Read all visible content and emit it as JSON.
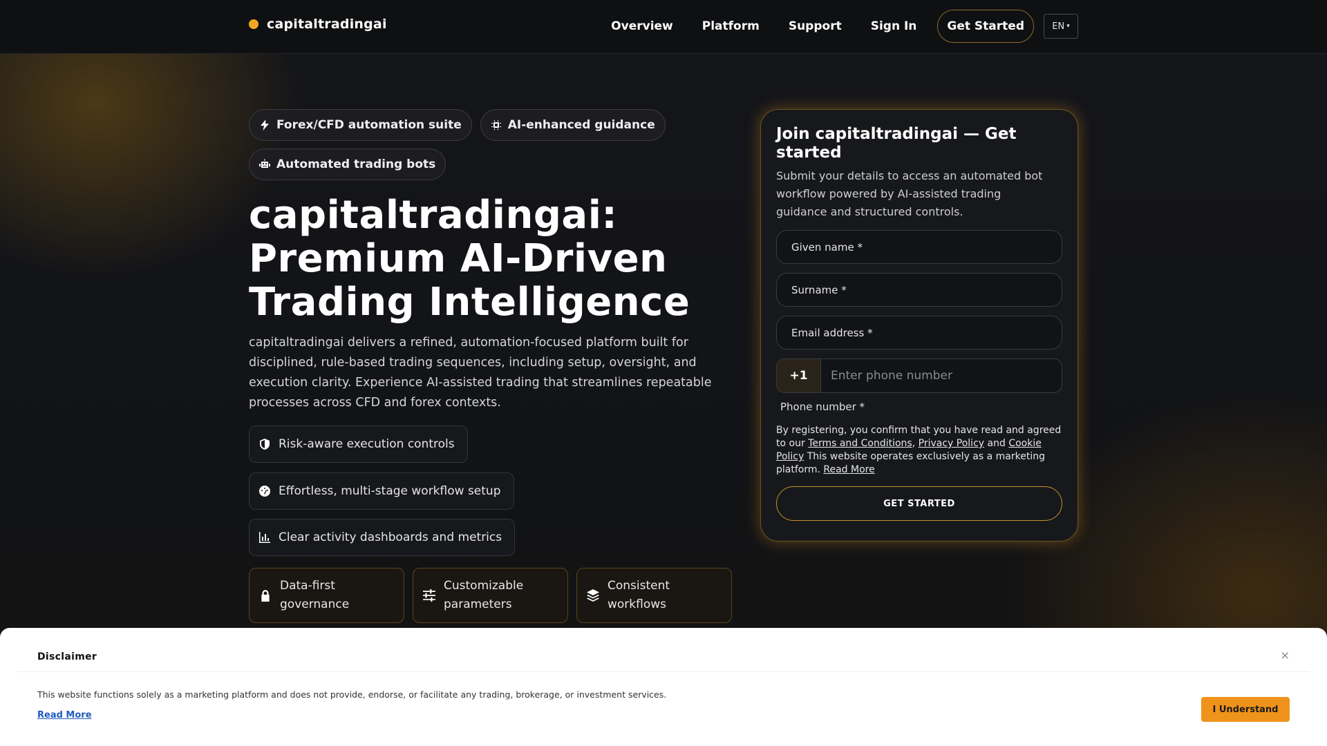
{
  "header": {
    "logo_text": "capitaltradingai",
    "nav": [
      "Overview",
      "Platform",
      "Support",
      "Sign In"
    ],
    "cta_label": "Get Started",
    "language": "EN",
    "language_caret": "▾"
  },
  "hero": {
    "chips": [
      {
        "label": "Forex/CFD automation suite",
        "icon": "bolt-icon"
      },
      {
        "label": "AI-enhanced guidance",
        "icon": "chip-icon"
      },
      {
        "label": "Automated trading bots",
        "icon": "robot-icon"
      }
    ],
    "title": "capitaltradingai: Premium AI-Driven Trading Intelligence",
    "description": "capitaltradingai delivers a refined, automation-focused platform built for disci­plined, rule-based trading sequences, including setup, oversight, and execu­tion clarity. Experience AI-assisted trading that streamlines repeatable pro­cesses across CFD and forex contexts.",
    "features": [
      {
        "label": "Risk-aware execution controls",
        "icon": "shield-icon"
      },
      {
        "label": "Effortless, multi-stage workflow setup",
        "icon": "gauge-icon"
      },
      {
        "label": "Clear activity dashboards and metrics",
        "icon": "bar-chart-icon"
      }
    ],
    "cards": [
      {
        "label": "Data-first governance",
        "icon": "lock-icon"
      },
      {
        "label": "Customizable parameters",
        "icon": "sliders-icon"
      },
      {
        "label": "Consistent workflows",
        "icon": "layers-icon"
      }
    ]
  },
  "form": {
    "title": "Join capitaltradingai — Get started",
    "subtitle": "Submit your details to access an automated bot workflow powered by AI-assisted trading guidance and structured controls.",
    "given_name": "Given name *",
    "surname": "Surname *",
    "email": "Email address *",
    "phone_code": "+1",
    "phone_placeholder": "Enter phone number",
    "phone_label": "Phone number *",
    "legal_prefix": "By registering, you confirm that you have read and agreed to our",
    "terms_link": "Terms and Conditions",
    "comma": ",",
    "privacy_link": "Privacy Policy",
    "and": "and",
    "cookie_link": "Cookie Policy",
    "legal_suffix": "This website operates exclusively as a marketing plat­form.",
    "read_more_link": "Read More",
    "submit_label": "GET STARTED"
  },
  "disclaimer": {
    "title": "Disclaimer",
    "close": "×",
    "text": "This website functions solely as a marketing platform and does not provide, endorse, or facilitate any trading, brokerage, or investment services.",
    "read_more": "Read More",
    "button_label": "I Understand"
  },
  "colors": {
    "accent": "#f5a623",
    "button_orange": "#f0931a",
    "background": "#111214"
  }
}
